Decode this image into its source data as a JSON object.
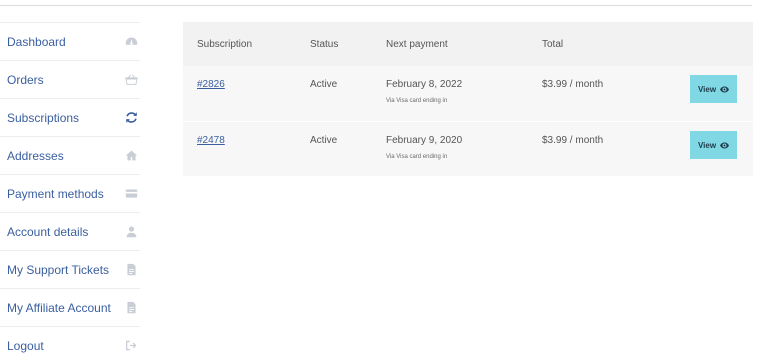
{
  "sidebar": {
    "items": [
      {
        "label": "Dashboard",
        "icon": "dashboard-icon"
      },
      {
        "label": "Orders",
        "icon": "basket-icon"
      },
      {
        "label": "Subscriptions",
        "icon": "refresh-icon",
        "active": true
      },
      {
        "label": "Addresses",
        "icon": "home-icon"
      },
      {
        "label": "Payment methods",
        "icon": "credit-card-icon"
      },
      {
        "label": "Account details",
        "icon": "user-icon"
      },
      {
        "label": "My Support Tickets",
        "icon": "document-icon"
      },
      {
        "label": "My Affiliate Account",
        "icon": "document-icon"
      },
      {
        "label": "Logout",
        "icon": "sign-out-icon"
      }
    ]
  },
  "table": {
    "headers": {
      "subscription": "Subscription",
      "status": "Status",
      "next_payment": "Next payment",
      "total": "Total"
    },
    "rows": [
      {
        "id": "#2826",
        "status": "Active",
        "next_payment": "February 8, 2022",
        "payment_via": "Via Visa card ending in",
        "total": "$3.99 / month",
        "action": "View"
      },
      {
        "id": "#2478",
        "status": "Active",
        "next_payment": "February 9, 2020",
        "payment_via": "Via Visa card ending in",
        "total": "$3.99 / month",
        "action": "View"
      }
    ]
  },
  "colors": {
    "link": "#3a5fa0",
    "button": "#7fd8e4",
    "icon_muted": "#c9ced6"
  }
}
